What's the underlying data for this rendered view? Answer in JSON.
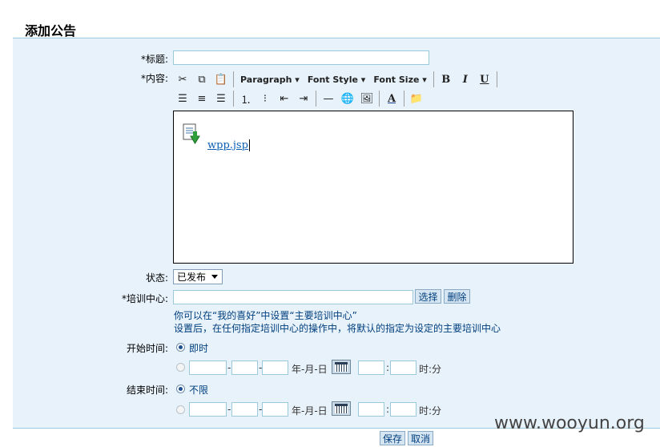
{
  "page_title": "添加公告",
  "form": {
    "title_label": "*标题:",
    "content_label": "*内容:",
    "status_label": "状态:",
    "training_center_label": "*培训中心:",
    "start_time_label": "开始时间:",
    "end_time_label": "结束时间:"
  },
  "toolbar": {
    "paragraph": "Paragraph",
    "font_style": "Font Style",
    "font_size": "Font Size",
    "bold": "B",
    "italic": "I",
    "underline": "U",
    "font_color": "A"
  },
  "editor": {
    "attachment_link": "wpp.jsp"
  },
  "status": {
    "selected": "已发布"
  },
  "training_center": {
    "select_button": "选择",
    "delete_button": "删除",
    "hint_line1": "你可以在“我的喜好”中设置“主要培训中心”",
    "hint_line2": "设置后，在任何指定培训中心的操作中，将默认的指定为设定的主要培训中心"
  },
  "start_time": {
    "option_now": "即时",
    "date_format": "年-月-日",
    "time_format": "时:分",
    "dash1": "-",
    "dash2": "-",
    "colon": ":"
  },
  "end_time": {
    "option_unlimited": "不限",
    "date_format": "年-月-日",
    "time_format": "时:分",
    "dash1": "-",
    "dash2": "-",
    "colon": ":"
  },
  "actions": {
    "save": "保存",
    "cancel": "取消"
  },
  "watermark": "www.wooyun.org"
}
